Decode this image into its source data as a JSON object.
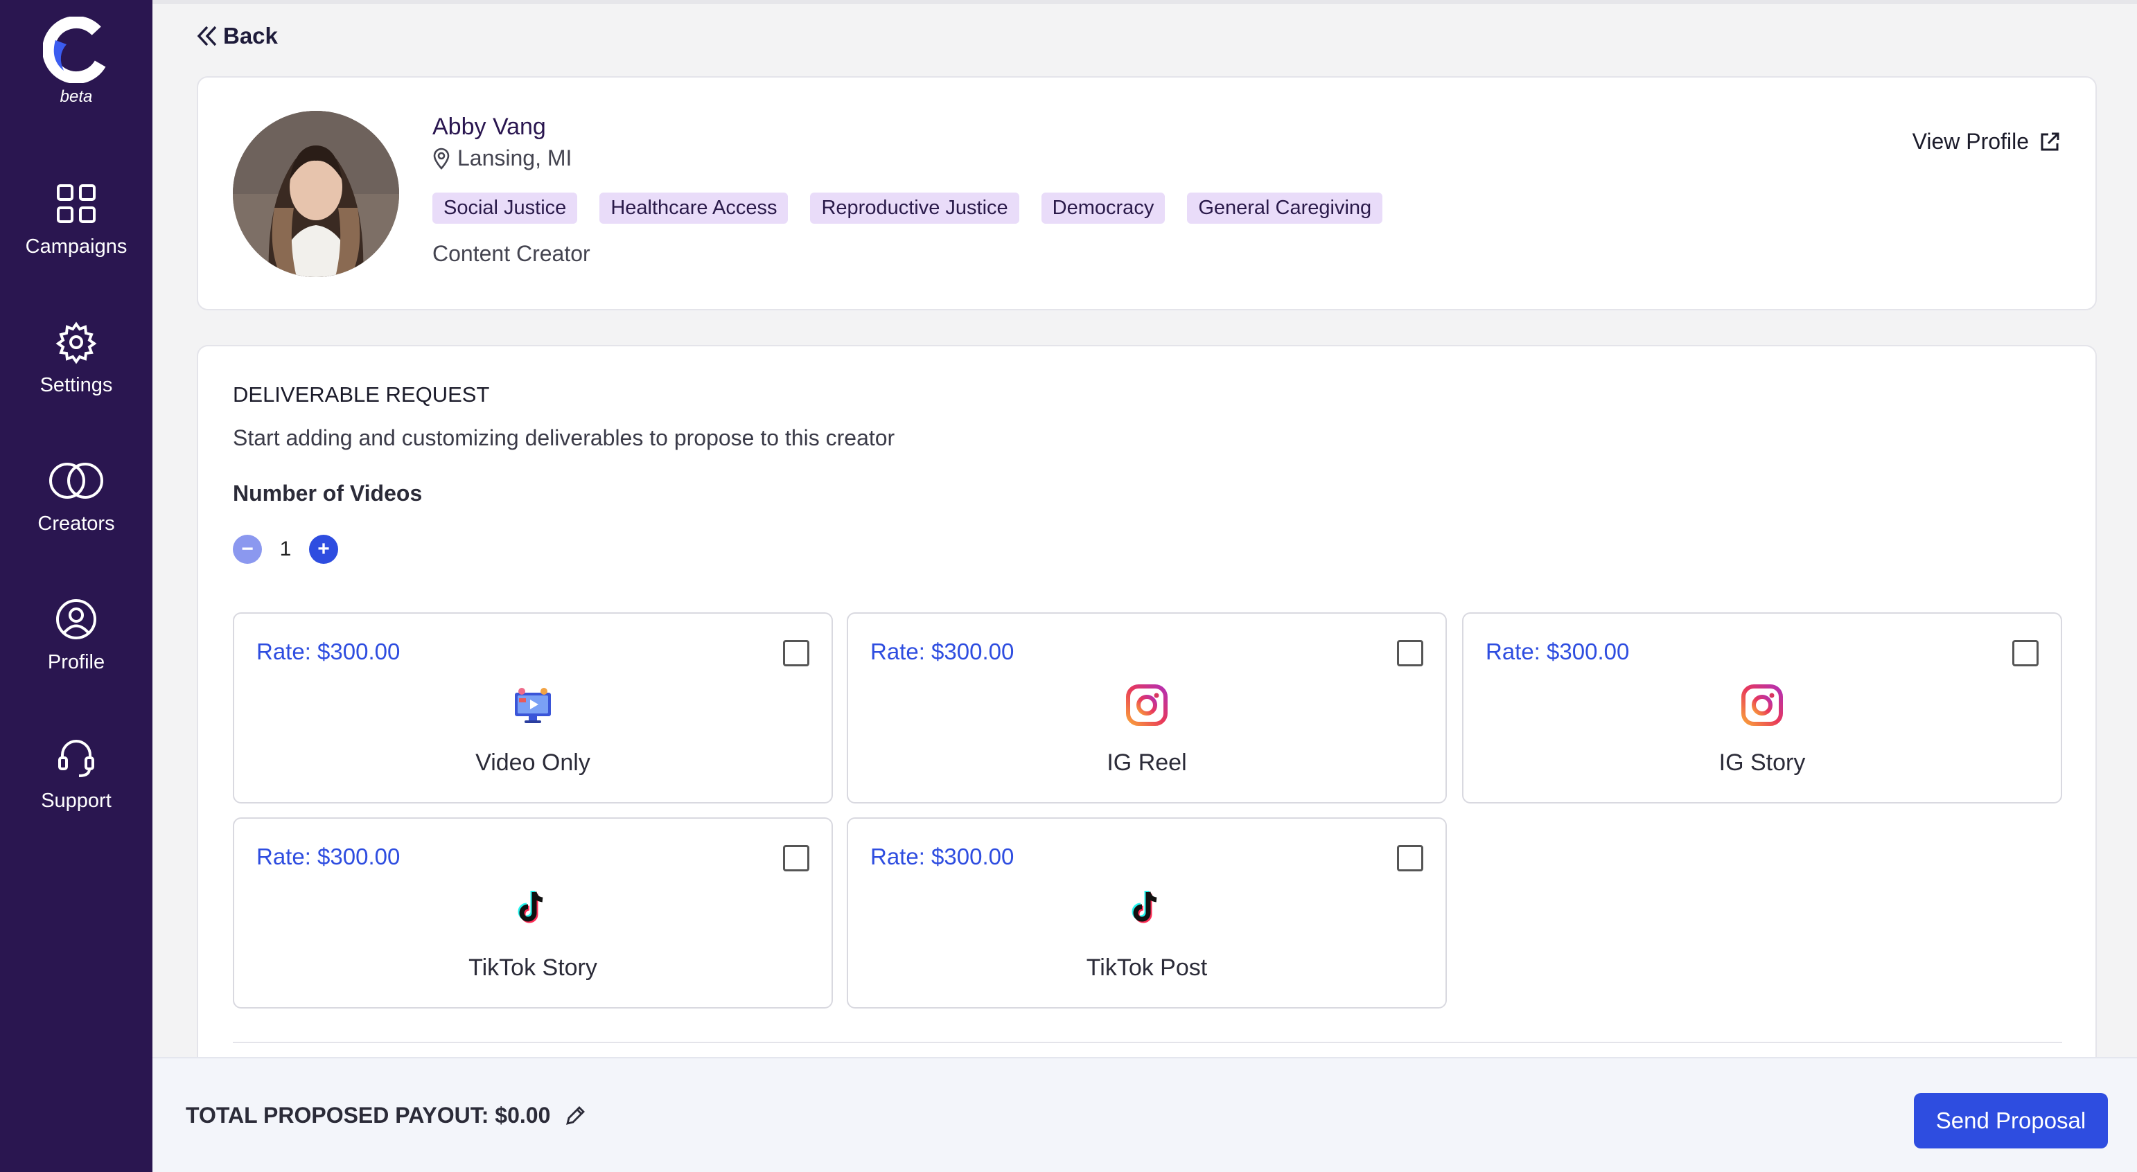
{
  "app": {
    "badge": "beta"
  },
  "sidebar": {
    "items": [
      {
        "label": "Campaigns",
        "icon": "grid-icon"
      },
      {
        "label": "Settings",
        "icon": "gear-icon"
      },
      {
        "label": "Creators",
        "icon": "rings-icon"
      },
      {
        "label": "Profile",
        "icon": "user-circle-icon"
      },
      {
        "label": "Support",
        "icon": "headset-icon"
      }
    ]
  },
  "nav": {
    "back_label": "Back"
  },
  "creator": {
    "name": "Abby Vang",
    "location": "Lansing, MI",
    "tags": [
      "Social Justice",
      "Healthcare Access",
      "Reproductive Justice",
      "Democracy",
      "General Caregiving"
    ],
    "role": "Content Creator",
    "view_profile_label": "View Profile"
  },
  "deliverables": {
    "section_title": "DELIVERABLE REQUEST",
    "description": "Start adding and customizing deliverables to propose to this creator",
    "count_label": "Number of Videos",
    "count_value": "1",
    "options": [
      {
        "rate": "Rate: $300.00",
        "label": "Video Only",
        "icon": "video-icon",
        "checked": false
      },
      {
        "rate": "Rate: $300.00",
        "label": "IG Reel",
        "icon": "instagram-icon",
        "checked": false
      },
      {
        "rate": "Rate: $300.00",
        "label": "IG Story",
        "icon": "instagram-icon",
        "checked": false
      },
      {
        "rate": "Rate: $300.00",
        "label": "TikTok Story",
        "icon": "tiktok-icon",
        "checked": false
      },
      {
        "rate": "Rate: $300.00",
        "label": "TikTok Post",
        "icon": "tiktok-icon",
        "checked": false
      }
    ]
  },
  "footer": {
    "payout_label": "TOTAL PROPOSED PAYOUT: $0.00",
    "send_label": "Send Proposal"
  },
  "colors": {
    "sidebar": "#2a1650",
    "accent": "#2e4de0",
    "tag_bg": "#e9dcf9"
  }
}
